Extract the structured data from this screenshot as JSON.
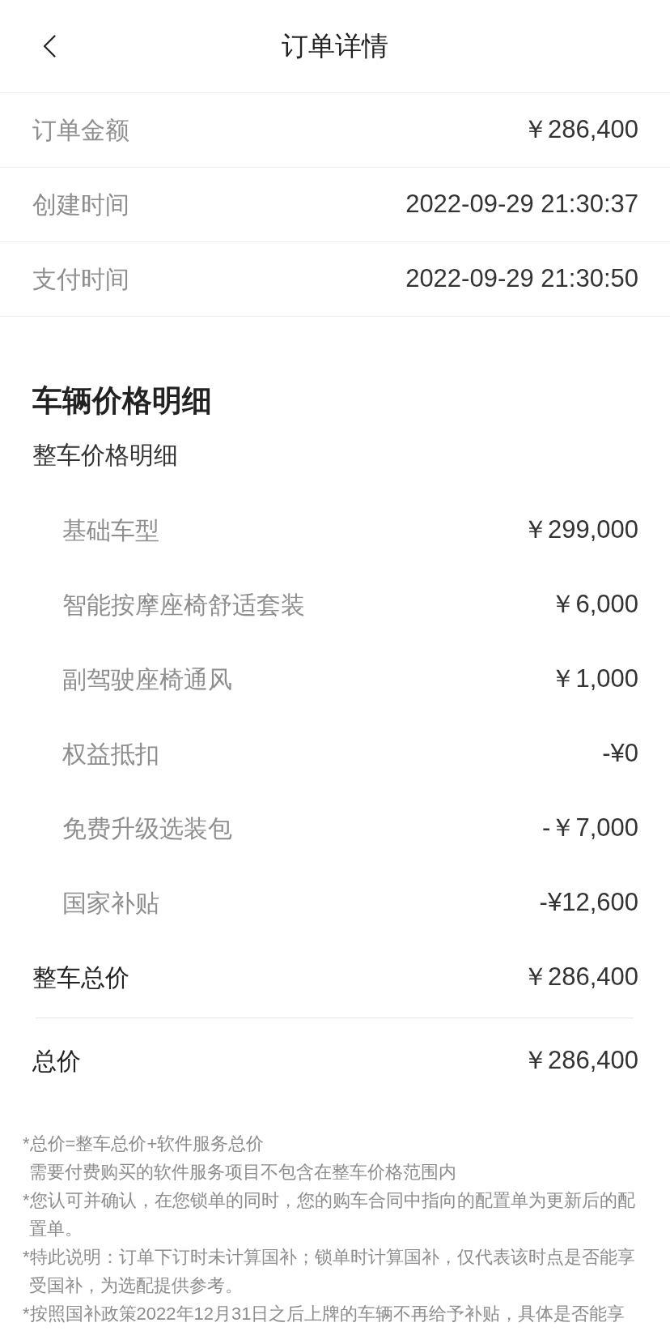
{
  "header": {
    "title": "订单详情"
  },
  "order_info": [
    {
      "label": "订单金额",
      "value": "￥286,400"
    },
    {
      "label": "创建时间",
      "value": "2022-09-29 21:30:37"
    },
    {
      "label": "支付时间",
      "value": "2022-09-29 21:30:50"
    }
  ],
  "vehicle_price": {
    "title": "车辆价格明细",
    "subtitle": "整车价格明细",
    "items": [
      {
        "label": "基础车型",
        "value": "￥299,000"
      },
      {
        "label": "智能按摩座椅舒适套装",
        "value": "￥6,000"
      },
      {
        "label": "副驾驶座椅通风",
        "value": "￥1,000"
      },
      {
        "label": "权益抵扣",
        "value": "-¥0"
      },
      {
        "label": "免费升级选装包",
        "value": "-￥7,000"
      },
      {
        "label": "国家补贴",
        "value": "-¥12,600"
      }
    ],
    "subtotal": {
      "label": "整车总价",
      "value": "￥286,400"
    }
  },
  "total": {
    "label": "总价",
    "value": "￥286,400"
  },
  "notes": [
    {
      "lines": [
        "*总价=整车总价+软件服务总价",
        "需要付费购买的软件服务项目不包含在整车价格范围内"
      ]
    },
    {
      "lines": [
        "*您认可并确认，在您锁单的同时，您的购车合同中指向的配置单为更新后的配",
        "置单。"
      ]
    },
    {
      "lines": [
        "*特此说明：订单下订时未计算国补；锁单时计算国补，仅代表该时点是否能享",
        "受国补，为选配提供参考。"
      ]
    },
    {
      "lines": [
        "*按照国补政策2022年12月31日之后上牌的车辆不再给予补贴，具体是否能享"
      ]
    }
  ]
}
